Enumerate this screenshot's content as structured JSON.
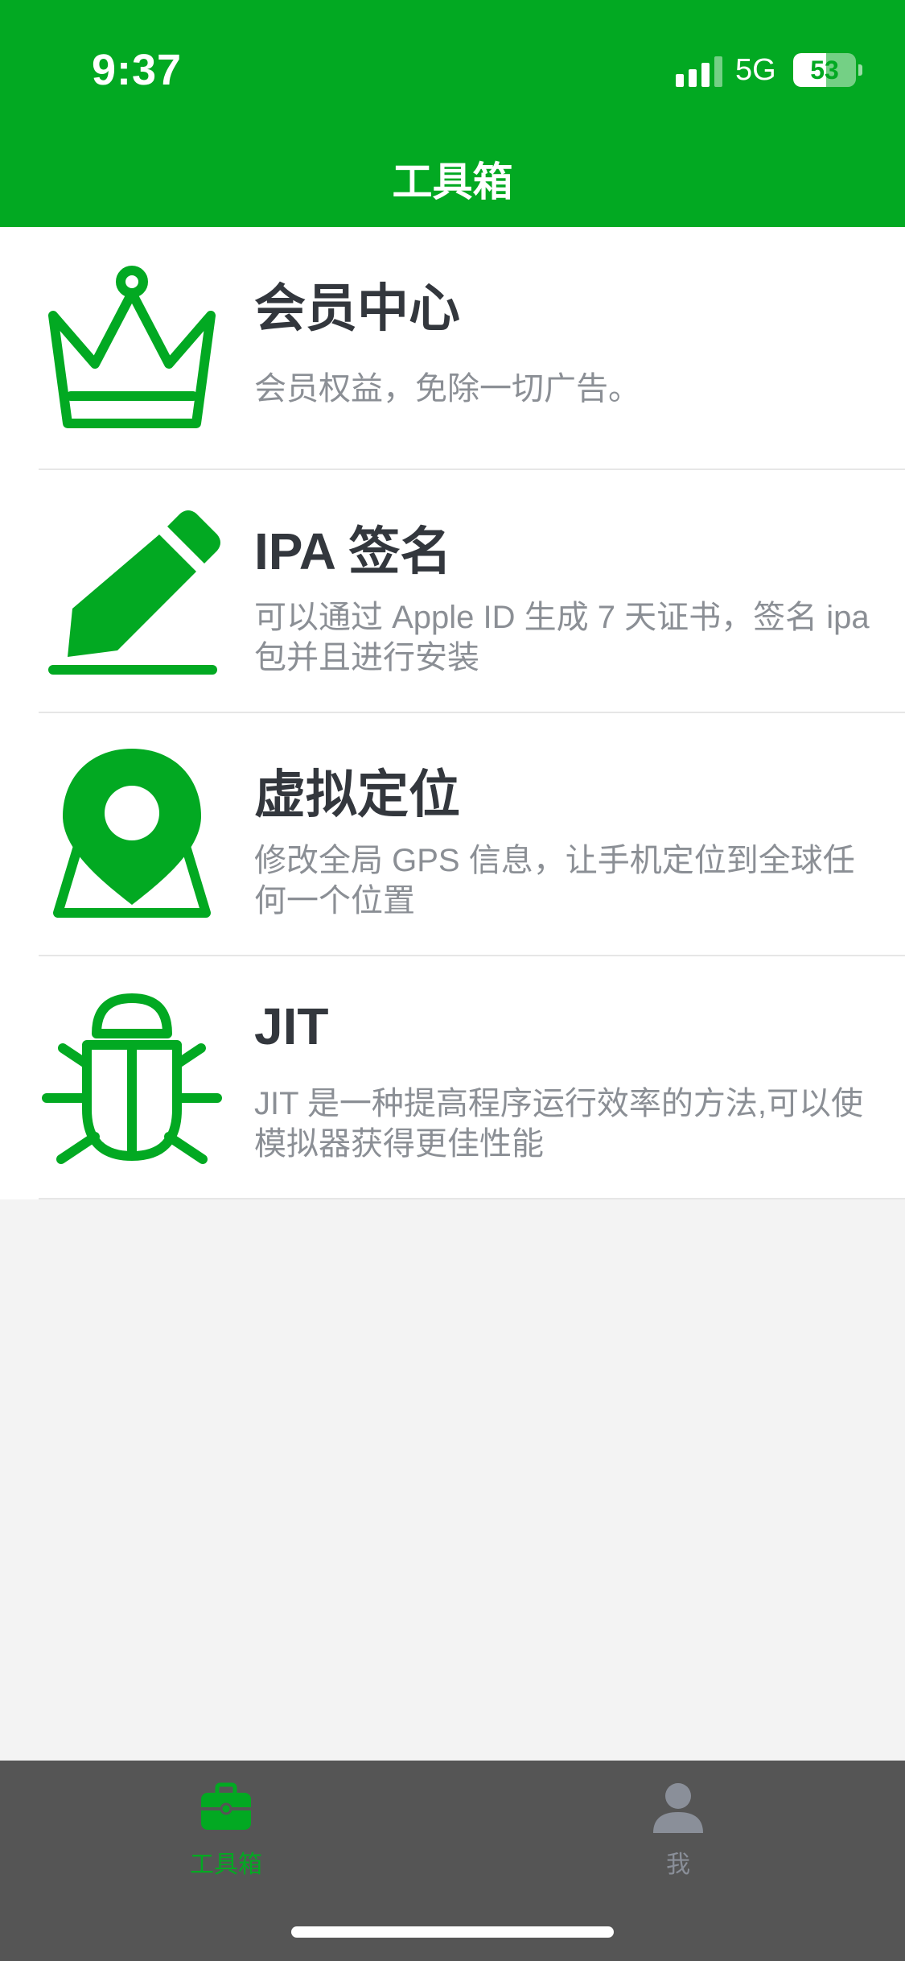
{
  "status_bar": {
    "time": "9:37",
    "network": "5G",
    "battery": "53",
    "battery_level": 0.53
  },
  "header": {
    "title": "工具箱"
  },
  "colors": {
    "brand_green": "#02a922",
    "title_text": "#33373d",
    "desc_text": "#8b8f95",
    "tabbar_bg": "#555555",
    "tab_inactive": "#8a8f99"
  },
  "list": {
    "items": [
      {
        "icon": "crown-icon",
        "title": "会员中心",
        "description": "会员权益，免除一切广告。"
      },
      {
        "icon": "pencil-icon",
        "title": "IPA 签名",
        "description": "可以通过 Apple ID 生成 7 天证书，签名 ipa 包并且进行安装"
      },
      {
        "icon": "map-pin-icon",
        "title": "虚拟定位",
        "description": "修改全局 GPS 信息，让手机定位到全球任何一个位置"
      },
      {
        "icon": "bug-icon",
        "title": "JIT",
        "description": "JIT 是一种提高程序运行效率的方法,可以使模拟器获得更佳性能"
      }
    ]
  },
  "tabbar": {
    "tabs": [
      {
        "label": "工具箱",
        "icon": "toolbox-icon",
        "active": true
      },
      {
        "label": "我",
        "icon": "user-icon",
        "active": false
      }
    ]
  }
}
